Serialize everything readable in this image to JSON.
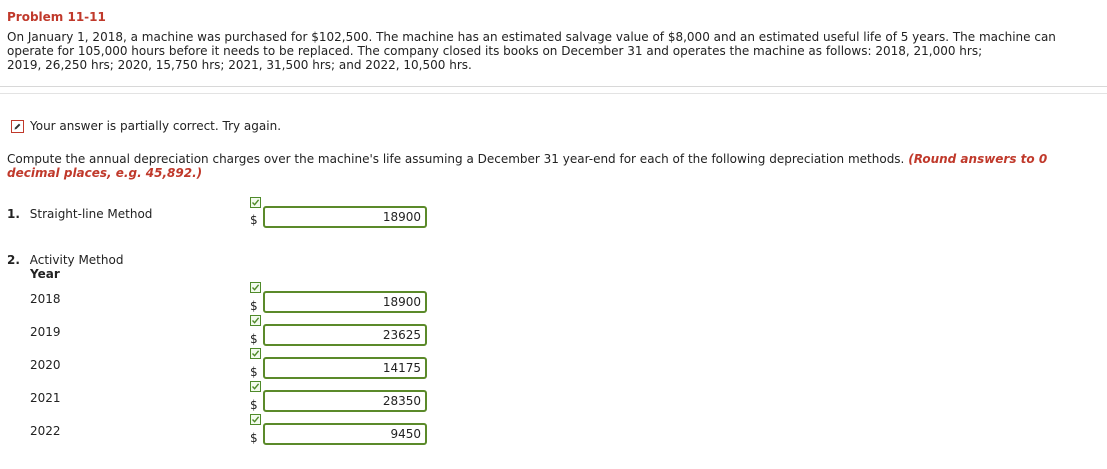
{
  "problem": {
    "title": "Problem 11-11",
    "line1": "On January 1, 2018, a machine was purchased for $102,500. The machine has an estimated salvage value of $8,000 and an estimated useful life of 5 years. The machine can",
    "line2": "operate for 105,000 hours before it needs to be replaced. The company closed its books on December 31 and operates the machine as follows: 2018, 21,000 hrs;",
    "line3": "2019, 26,250 hrs; 2020, 15,750 hrs; 2021, 31,500 hrs; and 2022, 10,500 hrs."
  },
  "status": {
    "icon": "pencil-icon",
    "text": "Your answer is partially correct.  Try again."
  },
  "instructions": {
    "text": "Compute the annual depreciation charges over the machine's life assuming a December 31 year-end for each of the following depreciation methods.",
    "emphasis": "(Round answers to 0 decimal places, e.g. 45,892.)"
  },
  "section1": {
    "number": "1.",
    "label": "Straight-line Method",
    "currency": "$",
    "value": "18900",
    "correct_icon": "check-icon"
  },
  "section2": {
    "number": "2.",
    "label": "Activity Method",
    "year_header": "Year",
    "currency": "$",
    "rows": [
      {
        "year": "2018",
        "value": "18900"
      },
      {
        "year": "2019",
        "value": "23625"
      },
      {
        "year": "2020",
        "value": "14175"
      },
      {
        "year": "2021",
        "value": "28350"
      },
      {
        "year": "2022",
        "value": "9450"
      }
    ]
  },
  "colors": {
    "title_red": "#c0392b",
    "input_border_green": "#5b8a2a",
    "check_green": "#4f8a2a"
  }
}
